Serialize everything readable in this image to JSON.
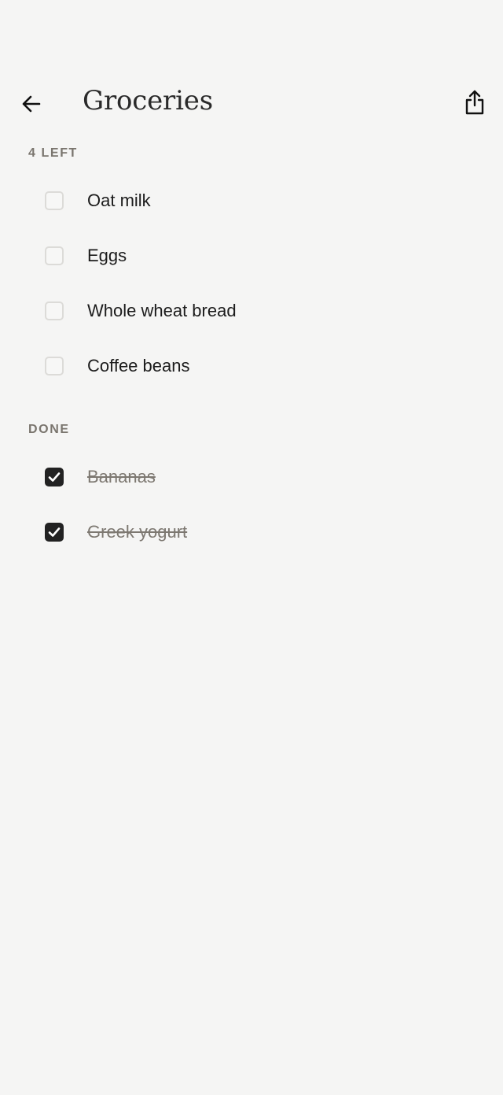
{
  "header": {
    "title": "Groceries",
    "back_icon": "arrow-left-icon",
    "share_icon": "share-icon"
  },
  "sections": {
    "remaining": {
      "label": "4 LEFT",
      "items": [
        {
          "label": "Oat milk",
          "checked": false
        },
        {
          "label": "Eggs",
          "checked": false
        },
        {
          "label": "Whole wheat bread",
          "checked": false
        },
        {
          "label": "Coffee beans",
          "checked": false
        }
      ]
    },
    "done": {
      "label": "DONE",
      "items": [
        {
          "label": "Bananas",
          "checked": true
        },
        {
          "label": "Greek yogurt",
          "checked": true
        }
      ]
    }
  },
  "colors": {
    "background": "#f5f5f4",
    "text": "#1c1c1c",
    "muted": "#7a756e",
    "checkbox_border": "#dcdbd8",
    "checkbox_checked": "#222222"
  }
}
